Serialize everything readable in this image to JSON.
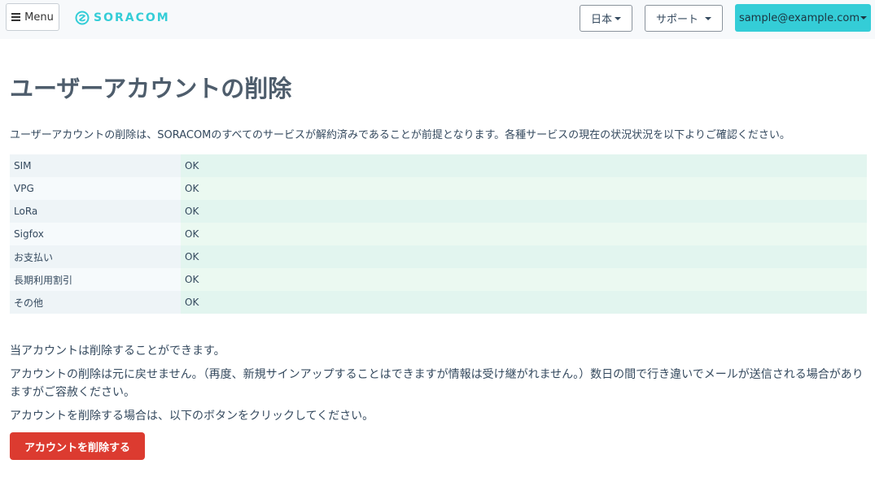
{
  "header": {
    "menu_label": "Menu",
    "brand": "SORACOM",
    "language_label": "日本",
    "support_label": "サポート",
    "account_label": "sample@example.com"
  },
  "main": {
    "title": "ユーザーアカウントの削除",
    "intro": "ユーザーアカウントの削除は、SORACOMのすべてのサービスが解約済みであることが前提となります。各種サービスの現在の状況状況を以下よりご確認ください。",
    "services": [
      {
        "name": "SIM",
        "status": "OK"
      },
      {
        "name": "VPG",
        "status": "OK"
      },
      {
        "name": "LoRa",
        "status": "OK"
      },
      {
        "name": "Sigfox",
        "status": "OK"
      },
      {
        "name": "お支払い",
        "status": "OK"
      },
      {
        "name": "長期利用割引",
        "status": "OK"
      },
      {
        "name": "その他",
        "status": "OK"
      }
    ],
    "can_delete_message": "当アカウントは削除することができます。",
    "warning_message": "アカウントの削除は元に戻せません。（再度、新規サインアップすることはできますが情報は受け継がれません。）数日の間で行き違いでメールが送信される場合がありますがご容赦ください。",
    "instruction_message": "アカウントを削除する場合は、以下のボタンをクリックしてください。",
    "delete_button_label": "アカウントを削除する"
  },
  "colors": {
    "brand": "#34cdd7",
    "danger": "#dc3b30",
    "text": "#34495e"
  }
}
